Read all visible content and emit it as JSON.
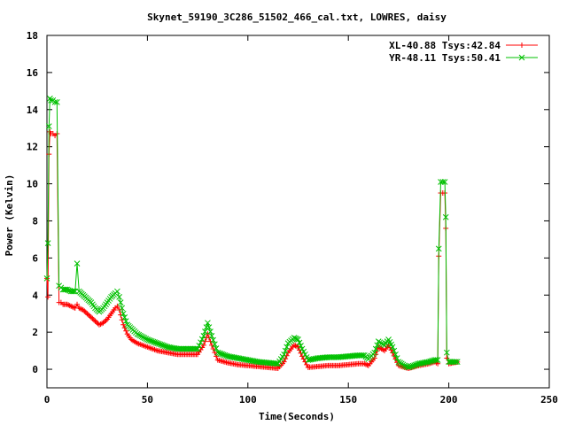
{
  "chart_data": {
    "type": "line",
    "title": "Skynet_59190_3C286_51502_466_cal.txt, LOWRES, daisy",
    "xlabel": "Time(Seconds)",
    "ylabel": "Power (Kelvin)",
    "xlim": [
      0,
      250
    ],
    "ylim": [
      -1,
      18
    ],
    "xticks": [
      "0",
      "50",
      "100",
      "150",
      "200",
      "250"
    ],
    "yticks": [
      "0",
      "2",
      "4",
      "6",
      "8",
      "10",
      "12",
      "14",
      "16",
      "18"
    ],
    "grid": false,
    "legend_position": "top-right",
    "series": [
      {
        "name": "XL-40.88 Tsys:42.84",
        "color": "#ff0000",
        "marker": "plus",
        "x": [
          0,
          0.5,
          1,
          1.5,
          2,
          3,
          4,
          5,
          6,
          7,
          8,
          10,
          12,
          14,
          15,
          16,
          18,
          20,
          22,
          24,
          26,
          28,
          30,
          32,
          34,
          35,
          36,
          38,
          40,
          42,
          45,
          50,
          55,
          60,
          65,
          70,
          75,
          78,
          80,
          82,
          85,
          90,
          95,
          100,
          105,
          110,
          115,
          118,
          120,
          123,
          125,
          127,
          130,
          135,
          140,
          145,
          150,
          155,
          158,
          160,
          163,
          165,
          168,
          170,
          172,
          175,
          178,
          180,
          185,
          190,
          193,
          194.5,
          195,
          196,
          197,
          198,
          198.5,
          199,
          200,
          202,
          205
        ],
        "y": [
          4.9,
          3.9,
          11.6,
          12.8,
          12.7,
          12.7,
          12.6,
          12.7,
          3.6,
          3.6,
          3.5,
          3.5,
          3.4,
          3.3,
          3.5,
          3.3,
          3.2,
          3.0,
          2.8,
          2.6,
          2.4,
          2.5,
          2.7,
          3.0,
          3.3,
          3.4,
          3.2,
          2.4,
          1.9,
          1.6,
          1.4,
          1.2,
          1.0,
          0.9,
          0.8,
          0.8,
          0.8,
          1.3,
          1.9,
          1.3,
          0.5,
          0.35,
          0.25,
          0.2,
          0.15,
          0.1,
          0.05,
          0.4,
          0.9,
          1.3,
          1.2,
          0.7,
          0.1,
          0.15,
          0.2,
          0.2,
          0.25,
          0.3,
          0.3,
          0.2,
          0.6,
          1.2,
          1.0,
          1.3,
          0.9,
          0.2,
          0.1,
          0.05,
          0.2,
          0.3,
          0.4,
          0.3,
          6.1,
          9.5,
          9.5,
          9.5,
          7.6,
          0.6,
          0.3,
          0.35,
          0.4
        ]
      },
      {
        "name": "YR-48.11 Tsys:50.41",
        "color": "#00c000",
        "marker": "cross",
        "x": [
          0,
          0.5,
          1,
          1.5,
          2,
          3,
          4,
          5,
          6,
          7,
          8,
          10,
          12,
          14,
          15,
          16,
          18,
          20,
          22,
          24,
          26,
          28,
          30,
          32,
          34,
          35,
          36,
          38,
          40,
          42,
          45,
          50,
          55,
          60,
          65,
          70,
          75,
          78,
          80,
          82,
          85,
          90,
          95,
          100,
          105,
          110,
          115,
          118,
          120,
          123,
          125,
          127,
          130,
          135,
          140,
          145,
          150,
          155,
          158,
          160,
          163,
          165,
          168,
          170,
          172,
          175,
          178,
          180,
          185,
          190,
          193,
          194.5,
          195,
          196,
          197,
          198,
          198.5,
          199,
          200,
          202,
          205
        ],
        "y": [
          4.9,
          6.8,
          13.1,
          14.6,
          14.5,
          14.5,
          14.4,
          14.4,
          4.5,
          4.4,
          4.3,
          4.3,
          4.2,
          4.2,
          5.7,
          4.2,
          4.0,
          3.8,
          3.6,
          3.3,
          3.1,
          3.3,
          3.6,
          3.9,
          4.1,
          4.2,
          3.9,
          3.0,
          2.4,
          2.2,
          1.9,
          1.6,
          1.4,
          1.2,
          1.1,
          1.1,
          1.1,
          1.8,
          2.5,
          1.8,
          0.9,
          0.7,
          0.6,
          0.5,
          0.4,
          0.35,
          0.3,
          0.8,
          1.4,
          1.7,
          1.6,
          1.1,
          0.5,
          0.6,
          0.65,
          0.65,
          0.7,
          0.75,
          0.75,
          0.55,
          0.9,
          1.5,
          1.3,
          1.6,
          1.2,
          0.4,
          0.2,
          0.1,
          0.3,
          0.4,
          0.5,
          0.5,
          6.5,
          10.1,
          10.1,
          10.1,
          8.2,
          0.9,
          0.4,
          0.4,
          0.4
        ]
      }
    ]
  }
}
